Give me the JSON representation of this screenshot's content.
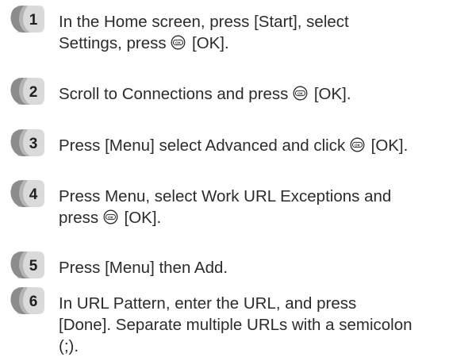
{
  "steps": [
    {
      "number": "1",
      "lines": [
        {
          "text": "In the Home screen, press [Start], select"
        },
        {
          "pre": "Settings, press ",
          "ok": true,
          "post": " [OK]."
        }
      ]
    },
    {
      "number": "2",
      "lines": [
        {
          "pre": "Scroll to Connections and press ",
          "ok": true,
          "post": " [OK]."
        }
      ]
    },
    {
      "number": "3",
      "lines": [
        {
          "pre": "Press [Menu] select Advanced and click ",
          "ok": true,
          "post": " [OK]."
        }
      ]
    },
    {
      "number": "4",
      "lines": [
        {
          "text": "Press Menu, select Work URL Exceptions and"
        },
        {
          "pre": "press ",
          "ok": true,
          "post": " [OK]."
        }
      ]
    },
    {
      "number": "5",
      "lines": [
        {
          "text": "Press [Menu] then Add."
        }
      ]
    },
    {
      "number": "6",
      "lines": [
        {
          "text": "In URL Pattern, enter the URL, and press"
        },
        {
          "text": "[Done]. Separate multiple URLs with a semicolon"
        },
        {
          "text": "(;)."
        }
      ]
    }
  ],
  "colors": {
    "text": "#2b2b2b",
    "badge_dark": "#8c8c8c",
    "badge_light": "#dadada",
    "badge_number": "#1f1f1f"
  },
  "icons": {
    "step_badge": "step-number-badge",
    "ok_button": "ok-button-icon"
  }
}
